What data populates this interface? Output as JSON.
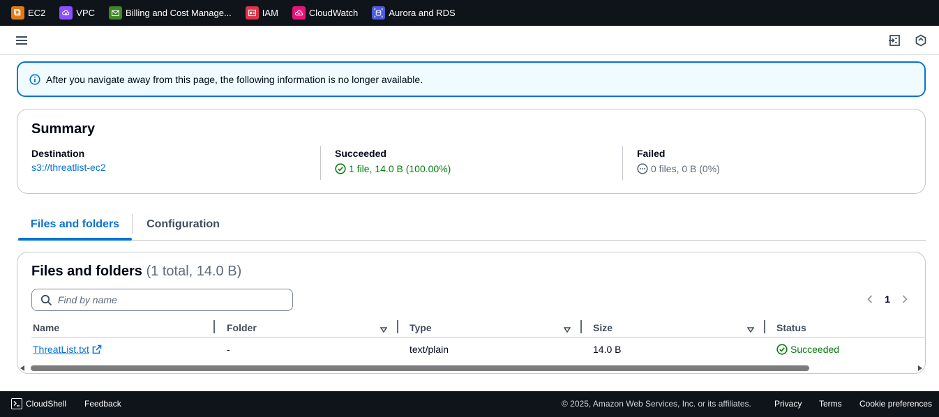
{
  "favorites": [
    {
      "label": "EC2",
      "color": "#e07b17",
      "icon": "ec2-icon"
    },
    {
      "label": "VPC",
      "color": "#8c4fff",
      "icon": "vpc-icon"
    },
    {
      "label": "Billing and Cost Manage...",
      "color": "#3f8624",
      "icon": "billing-icon"
    },
    {
      "label": "IAM",
      "color": "#dd344c",
      "icon": "iam-icon"
    },
    {
      "label": "CloudWatch",
      "color": "#e7157b",
      "icon": "cloudwatch-icon"
    },
    {
      "label": "Aurora and RDS",
      "color": "#4d5bdb",
      "icon": "rds-icon"
    }
  ],
  "flash": {
    "text": "After you navigate away from this page, the following information is no longer available."
  },
  "summary": {
    "title": "Summary",
    "destination_label": "Destination",
    "destination_value": "s3://threatlist-ec2",
    "succeeded_label": "Succeeded",
    "succeeded_value": "1 file, 14.0 B (100.00%)",
    "failed_label": "Failed",
    "failed_value": "0 files, 0 B (0%)"
  },
  "tabs": [
    {
      "label": "Files and folders",
      "active": true
    },
    {
      "label": "Configuration",
      "active": false
    }
  ],
  "files": {
    "title": "Files and folders",
    "count": "(1 total, 14.0 B)",
    "search_placeholder": "Find by name",
    "current_page": "1",
    "columns": [
      "Name",
      "Folder",
      "Type",
      "Size",
      "Status"
    ],
    "rows": [
      {
        "name": "ThreatList.txt",
        "folder": "-",
        "type": "text/plain",
        "size": "14.0 B",
        "status": "Succeeded"
      }
    ]
  },
  "footer": {
    "cloudshell": "CloudShell",
    "feedback": "Feedback",
    "copyright": "© 2025, Amazon Web Services, Inc. or its affiliates.",
    "privacy": "Privacy",
    "terms": "Terms",
    "cookies": "Cookie preferences"
  },
  "colors": {
    "link": "#0972d3",
    "success": "#037f0c",
    "nav_dark": "#0f141a"
  }
}
